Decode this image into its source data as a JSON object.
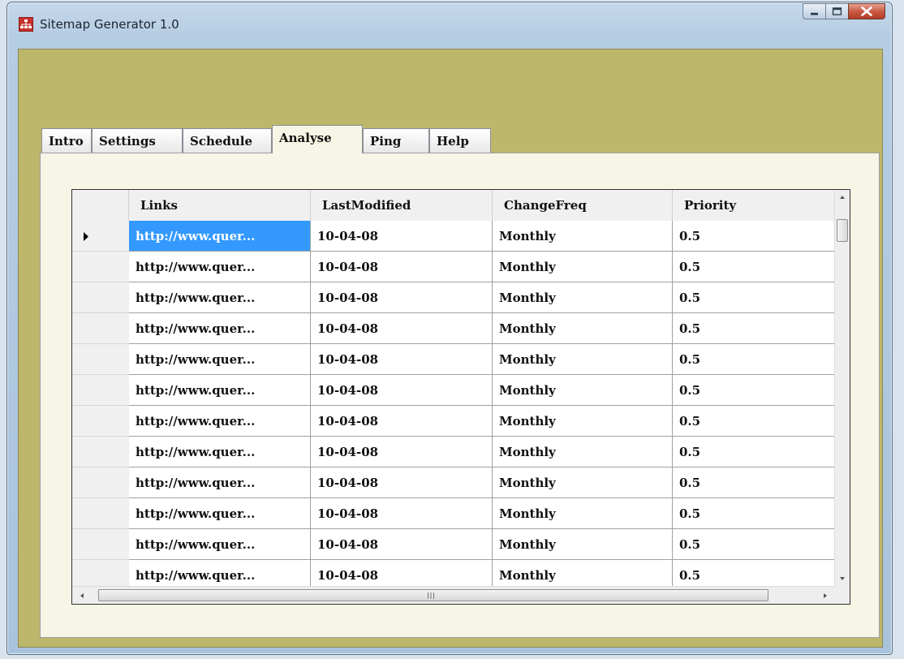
{
  "window": {
    "title": "Sitemap Generator 1.0",
    "icons": {
      "app": "sitemap-icon",
      "minimize": "minimize-icon",
      "maximize": "maximize-icon",
      "close": "close-icon"
    }
  },
  "colors": {
    "client_bg": "#bdb76b",
    "panel_bg": "#f6f5e6",
    "selection": "#3399ff"
  },
  "tabs": [
    {
      "label": "Intro"
    },
    {
      "label": "Settings"
    },
    {
      "label": "Schedule"
    },
    {
      "label": "Analyse",
      "active": true
    },
    {
      "label": "Ping"
    },
    {
      "label": "Help"
    }
  ],
  "grid": {
    "columns": [
      "Links",
      "LastModified",
      "ChangeFreq",
      "Priority"
    ],
    "rows": [
      {
        "link": "http://www.quer...",
        "last_modified": "10-04-08",
        "change_freq": "Monthly",
        "priority": "0.5"
      },
      {
        "link": "http://www.quer...",
        "last_modified": "10-04-08",
        "change_freq": "Monthly",
        "priority": "0.5"
      },
      {
        "link": "http://www.quer...",
        "last_modified": "10-04-08",
        "change_freq": "Monthly",
        "priority": "0.5"
      },
      {
        "link": "http://www.quer...",
        "last_modified": "10-04-08",
        "change_freq": "Monthly",
        "priority": "0.5"
      },
      {
        "link": "http://www.quer...",
        "last_modified": "10-04-08",
        "change_freq": "Monthly",
        "priority": "0.5"
      },
      {
        "link": "http://www.quer...",
        "last_modified": "10-04-08",
        "change_freq": "Monthly",
        "priority": "0.5"
      },
      {
        "link": "http://www.quer...",
        "last_modified": "10-04-08",
        "change_freq": "Monthly",
        "priority": "0.5"
      },
      {
        "link": "http://www.quer...",
        "last_modified": "10-04-08",
        "change_freq": "Monthly",
        "priority": "0.5"
      },
      {
        "link": "http://www.quer...",
        "last_modified": "10-04-08",
        "change_freq": "Monthly",
        "priority": "0.5"
      },
      {
        "link": "http://www.quer...",
        "last_modified": "10-04-08",
        "change_freq": "Monthly",
        "priority": "0.5"
      },
      {
        "link": "http://www.quer...",
        "last_modified": "10-04-08",
        "change_freq": "Monthly",
        "priority": "0.5"
      },
      {
        "link": "http://www.quer...",
        "last_modified": "10-04-08",
        "change_freq": "Monthly",
        "priority": "0.5"
      }
    ]
  }
}
